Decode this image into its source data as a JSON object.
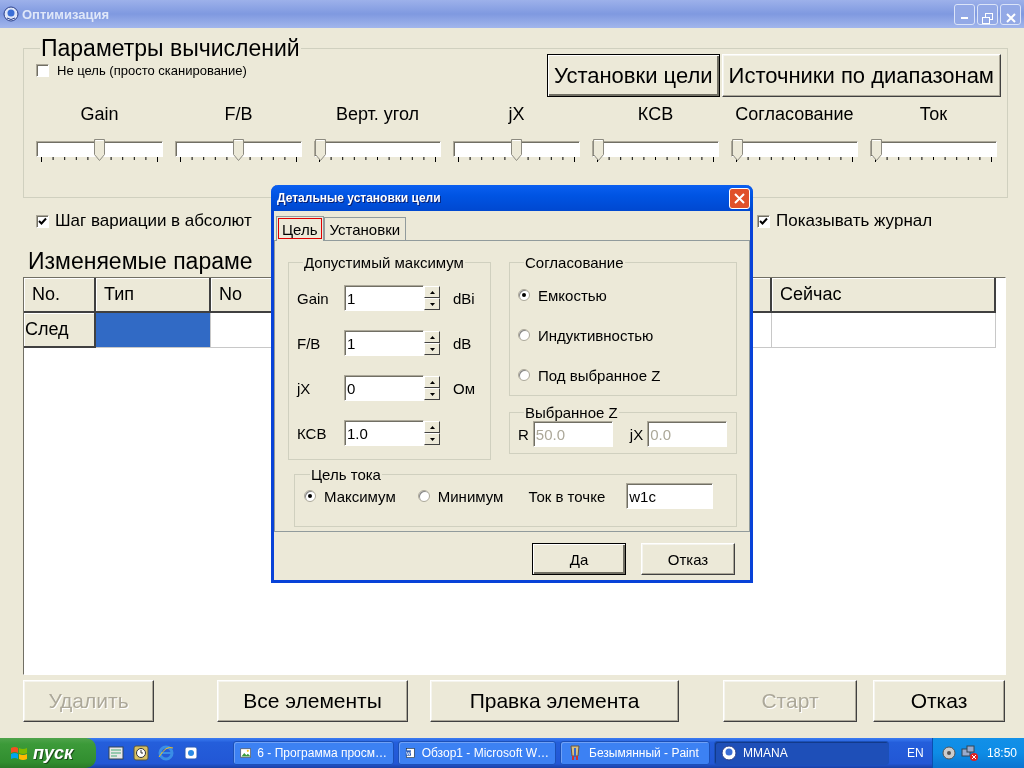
{
  "window": {
    "title": "Оптимизация"
  },
  "calc_params": {
    "title": "Параметры вычислений",
    "no_target": {
      "label": "Не цель (просто сканирование)",
      "checked": false
    },
    "buttons": [
      {
        "label": "Установки цели",
        "default": true
      },
      {
        "label": "Источники по диапазонам",
        "default": false
      }
    ],
    "sliders": [
      {
        "label": "Gain",
        "level": 0.5
      },
      {
        "label": "F/B",
        "level": 0.5
      },
      {
        "label": "Верт. угол",
        "level": 0
      },
      {
        "label": "jX",
        "level": 0.5
      },
      {
        "label": "КСВ",
        "level": 0
      },
      {
        "label": "Согласование",
        "level": 0
      },
      {
        "label": "Ток",
        "level": 0
      }
    ]
  },
  "options": [
    {
      "label": "Шаг вариации в абсолют",
      "checked": true
    },
    {
      "label": "Показывать журнал",
      "checked": true
    }
  ],
  "table": {
    "title": "Изменяемые параме",
    "columns": [
      "No.",
      "Тип",
      "No",
      "Сейчас"
    ],
    "rows": [
      {
        "header": "След",
        "cells": [
          {
            "selected": true
          },
          {
            "selected": false
          },
          {
            "selected": false
          }
        ]
      }
    ]
  },
  "buttons": [
    {
      "label": "Удалить",
      "disabled": true
    },
    {
      "label": "Все элементы",
      "disabled": false
    },
    {
      "label": "Правка элемента",
      "disabled": false
    },
    {
      "label": "Старт",
      "disabled": true
    },
    {
      "label": "Отказ",
      "disabled": false
    }
  ],
  "dialog": {
    "title": "Детальные установки цели",
    "tabs": [
      {
        "label": "Цель",
        "selected": true
      },
      {
        "label": "Установки",
        "selected": false
      }
    ],
    "limits": {
      "title": "Допустимый максимум",
      "rows": [
        {
          "label": "Gain",
          "value": "1",
          "unit": "dBi"
        },
        {
          "label": "F/B",
          "value": "1",
          "unit": "dB"
        },
        {
          "label": "jX",
          "value": "0",
          "unit": "Ом"
        },
        {
          "label": "КСВ",
          "value": "1.0"
        }
      ]
    },
    "matching": {
      "title": "Согласование",
      "options": [
        {
          "label": "Емкостью",
          "selected": true
        },
        {
          "label": "Индуктивностью",
          "selected": false
        },
        {
          "label": "Под выбранное Z",
          "selected": false
        }
      ]
    },
    "chosen_z": {
      "title": "Выбранное Z",
      "fields": [
        {
          "label": "R",
          "value": "50.0",
          "disabled": true
        },
        {
          "label": "jX",
          "value": "0.0",
          "disabled": true
        }
      ]
    },
    "current_target": {
      "title": "Цель тока",
      "options": [
        {
          "label": "Максимум",
          "selected": true
        },
        {
          "label": "Минимум",
          "selected": false
        }
      ],
      "point": {
        "label": "Ток в точке",
        "value": "w1c"
      }
    },
    "buttons": [
      {
        "label": "Да",
        "default": true
      },
      {
        "label": "Отказ",
        "default": false
      }
    ]
  },
  "taskbar": {
    "start": "пуск",
    "tasks": [
      {
        "label": "6 - Программа просм…",
        "kind": "viewer",
        "selected": false
      },
      {
        "label": "Обзор1 - Microsoft W…",
        "kind": "document",
        "selected": false
      },
      {
        "label": "Безымянный - Paint",
        "kind": "paint",
        "selected": false
      },
      {
        "label": "MMANA",
        "kind": "app",
        "selected": true
      }
    ],
    "language": "EN",
    "clock": "18:50"
  }
}
